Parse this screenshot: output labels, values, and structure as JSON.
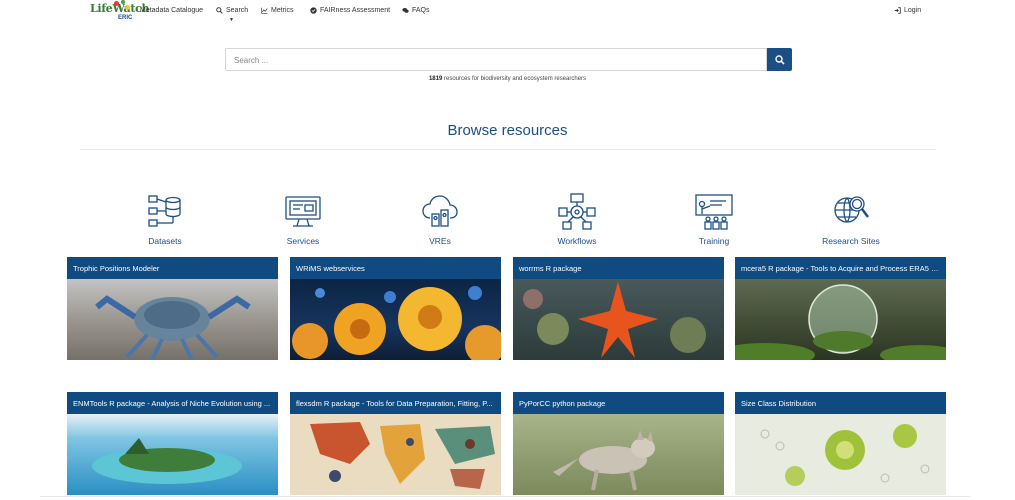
{
  "nav": {
    "logo_text": "LifeWatch",
    "logo_sub": "ERIC",
    "catalogue": "Metadata Catalogue",
    "search": "Search",
    "metrics": "Metrics",
    "fairness": "FAIRness Assessment",
    "faqs": "FAQs",
    "login": "Login"
  },
  "search": {
    "placeholder": "Search ..."
  },
  "stats": {
    "count": "1819",
    "text": "resources for biodiversity and ecosystem researchers"
  },
  "browse_title": "Browse resources",
  "categories": [
    {
      "label": "Datasets",
      "icon": "datasets-icon"
    },
    {
      "label": "Services",
      "icon": "services-icon"
    },
    {
      "label": "VREs",
      "icon": "vres-icon"
    },
    {
      "label": "Workflows",
      "icon": "workflows-icon"
    },
    {
      "label": "Training",
      "icon": "training-icon"
    },
    {
      "label": "Research Sites",
      "icon": "research-sites-icon"
    }
  ],
  "cards": [
    {
      "title": "Trophic Positions Modeler"
    },
    {
      "title": "WRiMS webservices"
    },
    {
      "title": "worrms R package"
    },
    {
      "title": "mcera5 R package - Tools to Acquire and Process ERA5 D..."
    },
    {
      "title": "ENMTools R package - Analysis of Niche Evolution using ..."
    },
    {
      "title": "flexsdm R package - Tools for Data Preparation, Fitting, P..."
    },
    {
      "title": "PyPorCC python package"
    },
    {
      "title": "Size Class Distribution"
    }
  ],
  "colors": {
    "brand": "#1c4e86",
    "card_header": "#0f4a80"
  }
}
